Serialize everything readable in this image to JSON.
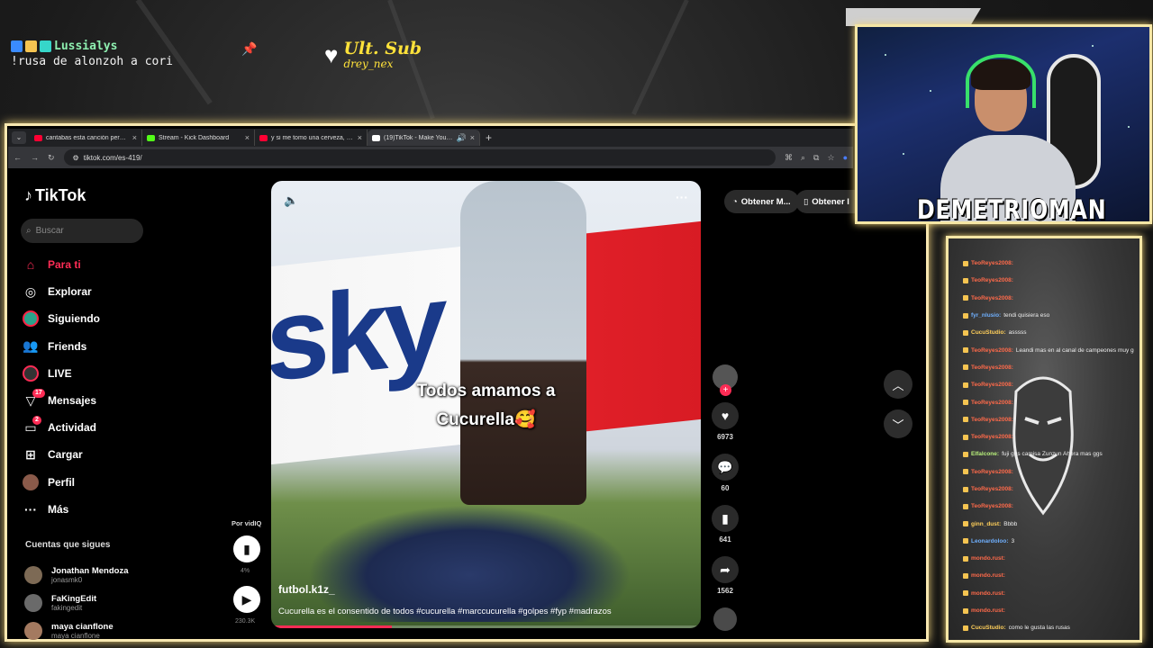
{
  "overlay": {
    "chat_user": "Lussialys",
    "chat_message": "!rusa de alonzoh a cori",
    "ult_sub_title": "Ult. Sub",
    "ult_sub_name": "drey_nex",
    "streamer_name": "DEMETRIOMAN"
  },
  "browser": {
    "tabs": [
      {
        "title": "cantabas esta canción pero no",
        "favicon_color": "#ff0033"
      },
      {
        "title": "Stream - Kick Dashboard",
        "favicon_color": "#53fc18"
      },
      {
        "title": "y si me tomo una cerveza, vuel",
        "favicon_color": "#ff0033"
      },
      {
        "title": "(19)TikTok - Make Your Day",
        "favicon_color": "#ffffff"
      }
    ],
    "url": "tiktok.com/es-419/"
  },
  "tiktok": {
    "logo": "TikTok",
    "search_placeholder": "Buscar",
    "nav": [
      {
        "label": "Para ti",
        "icon": "home-icon"
      },
      {
        "label": "Explorar",
        "icon": "compass-icon"
      },
      {
        "label": "Siguiendo",
        "icon": "following-avatar-icon"
      },
      {
        "label": "Friends",
        "icon": "friends-icon"
      },
      {
        "label": "LIVE",
        "icon": "live-icon"
      },
      {
        "label": "Mensajes",
        "icon": "messages-icon",
        "badge": "17"
      },
      {
        "label": "Actividad",
        "icon": "activity-icon",
        "badge": "2"
      },
      {
        "label": "Cargar",
        "icon": "upload-icon"
      },
      {
        "label": "Perfil",
        "icon": "profile-icon"
      },
      {
        "label": "Más",
        "icon": "more-icon"
      }
    ],
    "following_title": "Cuentas que sigues",
    "following": [
      {
        "name": "Jonathan Mendoza",
        "handle": "jonasmk0"
      },
      {
        "name": "FaKingEdit",
        "handle": "fakingedit"
      },
      {
        "name": "maya cianflone",
        "handle": "maya cianflone"
      }
    ],
    "vidiq_label": "Por vidIQ",
    "vidiq_percent": "4%",
    "vidiq_views": "230.3K",
    "video": {
      "caption_line1": "Todos amamos a",
      "caption_line2": "Cucurella🥰",
      "author": "futbol.k1z_",
      "description": "Cucurella es el consentido de todos #cucurella #marccucurella #golpes #fyp #madrazos",
      "progress": 0.28
    },
    "actions": {
      "likes": "6973",
      "comments": "60",
      "saves": "641",
      "shares": "1562"
    },
    "top_pills": [
      "Obtener M...",
      "Obtener l"
    ]
  },
  "chat_panel": {
    "messages": [
      {
        "user": "TeoReyes2008",
        "text": "",
        "color": "red"
      },
      {
        "user": "TeoReyes2008",
        "text": "",
        "color": "red"
      },
      {
        "user": "TeoReyes2008",
        "text": "",
        "color": "red"
      },
      {
        "user": "fyr_nlusio",
        "text": "tendi quisiera eso",
        "color": "blue"
      },
      {
        "user": "CucuStudio",
        "text": "asssss",
        "color": "yellow"
      },
      {
        "user": "TeoReyes2008",
        "text": "Leandi mas en al canal de campeones muy ggs",
        "color": "red"
      },
      {
        "user": "TeoReyes2008",
        "text": "",
        "color": "red"
      },
      {
        "user": "TeoReyes2008",
        "text": "",
        "color": "red"
      },
      {
        "user": "TeoReyes2008",
        "text": "",
        "color": "red"
      },
      {
        "user": "TeoReyes2008",
        "text": "",
        "color": "red"
      },
      {
        "user": "TeoReyes2008",
        "text": "",
        "color": "red"
      },
      {
        "user": "Elfalcone",
        "text": "fuji ggs camisa Zunzun Ahora mas ggs",
        "color": "green"
      },
      {
        "user": "TeoReyes2008",
        "text": "",
        "color": "red"
      },
      {
        "user": "TeoReyes2008",
        "text": "",
        "color": "red"
      },
      {
        "user": "TeoReyes2008",
        "text": "",
        "color": "red"
      },
      {
        "user": "ginn_dust",
        "text": "Bbbb",
        "color": "yellow"
      },
      {
        "user": "Leonardoloo",
        "text": "3",
        "color": "blue"
      },
      {
        "user": "mondo.rust",
        "text": "",
        "color": "red"
      },
      {
        "user": "mondo.rust",
        "text": "",
        "color": "red"
      },
      {
        "user": "mondo.rust",
        "text": "",
        "color": "red"
      },
      {
        "user": "mondo.rust",
        "text": "",
        "color": "red"
      },
      {
        "user": "CucuStudio",
        "text": "como le gusta las rusas",
        "color": "yellow"
      }
    ]
  }
}
